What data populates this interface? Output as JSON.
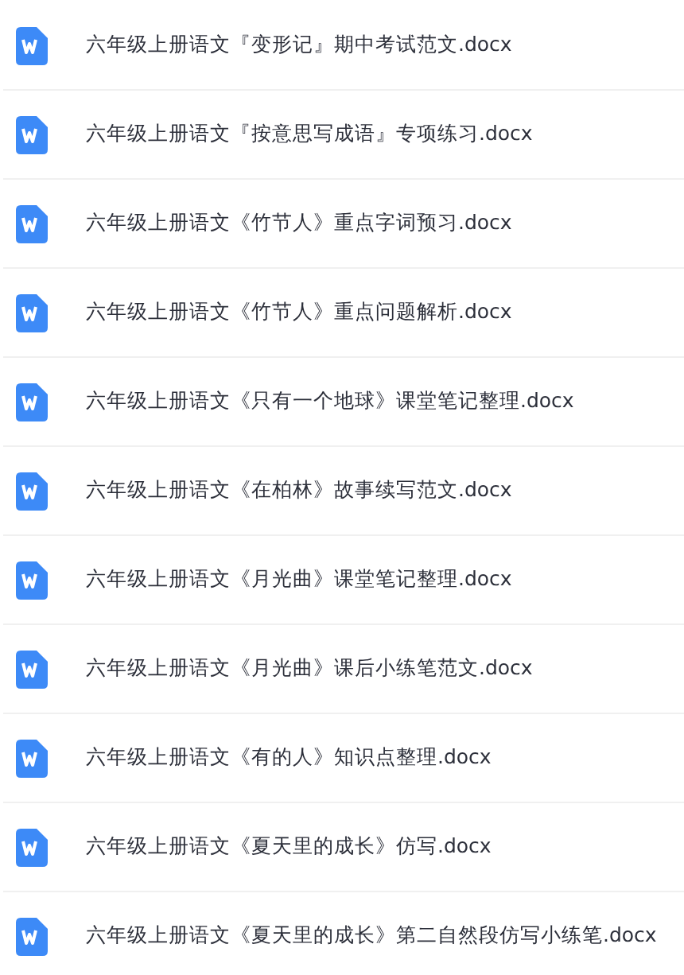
{
  "files": [
    {
      "name": "六年级上册语文『变形记』期中考试范文.docx"
    },
    {
      "name": "六年级上册语文『按意思写成语』专项练习.docx"
    },
    {
      "name": "六年级上册语文《竹节人》重点字词预习.docx"
    },
    {
      "name": "六年级上册语文《竹节人》重点问题解析.docx"
    },
    {
      "name": "六年级上册语文《只有一个地球》课堂笔记整理.docx"
    },
    {
      "name": "六年级上册语文《在柏林》故事续写范文.docx"
    },
    {
      "name": "六年级上册语文《月光曲》课堂笔记整理.docx"
    },
    {
      "name": "六年级上册语文《月光曲》课后小练笔范文.docx"
    },
    {
      "name": "六年级上册语文《有的人》知识点整理.docx"
    },
    {
      "name": "六年级上册语文《夏天里的成长》仿写.docx"
    },
    {
      "name": "六年级上册语文《夏天里的成长》第二自然段仿写小练笔.docx"
    }
  ]
}
